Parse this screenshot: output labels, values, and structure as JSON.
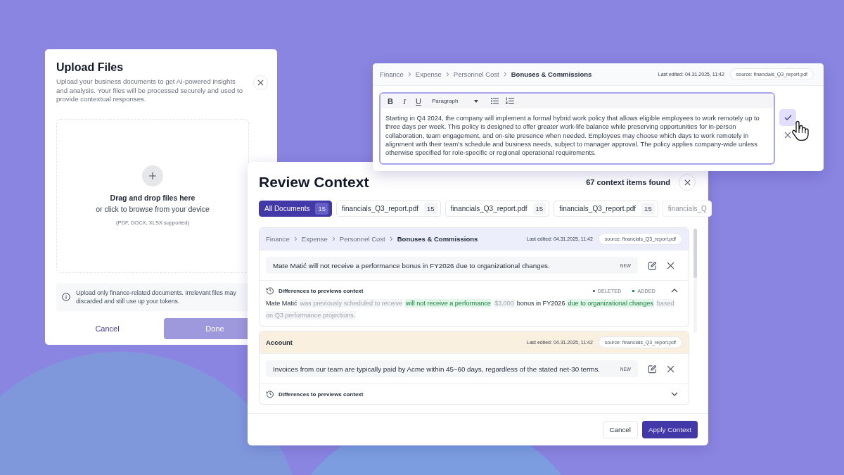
{
  "upload_dialog": {
    "title": "Upload Files",
    "description": "Upload your business documents to get AI-powered insights and analysis. Your files will be processed securely and used to provide contextual responses.",
    "dropzone": {
      "heading": "Drag and drop files here",
      "subheading": "or click to browse from your device",
      "formats": "(PDF, DOCX, XLSX supported)"
    },
    "note_lines": [
      "Upload only finance-related documents. Irrelevant files may",
      "discarded and still use up your tokens."
    ],
    "buttons": [
      {
        "label": "Cancel",
        "kind": "text",
        "disabled": false
      },
      {
        "label": "Done",
        "kind": "primary",
        "disabled": true
      }
    ]
  },
  "editor_panel": {
    "breadcrumb": [
      "Finance",
      "Expense",
      "Personnel Cost",
      "Bonuses & Commissions"
    ],
    "last_edited": "Last edited: 04.31.2025, 11:42",
    "source": "source: financials_Q3_report.pdf",
    "format_buttons": [
      {
        "label": "B",
        "kind": "bold"
      },
      {
        "label": "I",
        "kind": "italic"
      },
      {
        "label": "U",
        "kind": "underline"
      }
    ],
    "block_style": "Paragraph",
    "text": "Starting in Q4 2024, the company will implement a formal hybrid work policy that allows eligible employees to work remotely up to three days per week. This policy is designed to offer greater work-life balance while preserving opportunities for in-person collaboration, team engagement, and on-site presence when needed. Employees may choose which days to work remotely in alignment with their team’s schedule and business needs, subject to manager approval. The policy applies company-wide unless otherwise specified for role-specific or regional operational requirements."
  },
  "review_dialog": {
    "title": "Review Context",
    "count": "67 context items found",
    "tabs": [
      {
        "label": "All Documents",
        "count": "15",
        "selected": true,
        "faded": false
      },
      {
        "label": "financials_Q3_report.pdf",
        "count": "15",
        "selected": false,
        "faded": false
      },
      {
        "label": "financials_Q3_report.pdf",
        "count": "15",
        "selected": false,
        "faded": false
      },
      {
        "label": "financials_Q3_report.pdf",
        "count": "15",
        "selected": false,
        "faded": false
      },
      {
        "label": "financials_Q",
        "selected": false,
        "faded": true
      }
    ],
    "sections": [
      {
        "breadcrumb": [
          "Finance",
          "Expense",
          "Personnel Cost",
          "Bonuses & Commissions"
        ],
        "color": "#eceefc",
        "last_edited": "Last edited: 04.31.2025, 11:42",
        "source": "source: financials_Q3_report.pdf",
        "item": {
          "text": "Mate Matić will not receive a performance bonus in FY2026 due to organizational changes.",
          "badge": "NEW"
        },
        "diff": {
          "title": "Differences to previews context",
          "expanded": true,
          "legend": [
            {
              "label": "DELETED",
              "color": "#6b7280"
            },
            {
              "label": "ADDED",
              "color": "#16a34a"
            }
          ],
          "segments": [
            {
              "text": "Mate Matić",
              "kind": "normal"
            },
            {
              "text": "was previously scheduled to receive",
              "kind": "deleted"
            },
            {
              "text": "will not receive a performance",
              "kind": "added"
            },
            {
              "text": "$3,000",
              "kind": "deleted"
            },
            {
              "text": "bonus in FY2026",
              "kind": "normal"
            },
            {
              "text": "due to organizational changes",
              "kind": "added"
            },
            {
              "text": "based on Q3 performance projections.",
              "kind": "deleted"
            }
          ]
        }
      },
      {
        "breadcrumb": [
          "Account"
        ],
        "color": "#f9f0df",
        "last_edited": "Last edited: 04.31.2025, 11:42",
        "source": "source: financials_Q3_report.pdf",
        "item": {
          "text": "Invoices from our team are typically paid by Acme within 45–60 days, regardless of the stated net-30 terms.",
          "badge": "NEW"
        },
        "diff": {
          "title": "Differences to previews context",
          "expanded": false
        }
      }
    ],
    "buttons": [
      {
        "label": "Cancel",
        "kind": "secondary"
      },
      {
        "label": "Apply Context",
        "kind": "primary"
      }
    ]
  }
}
